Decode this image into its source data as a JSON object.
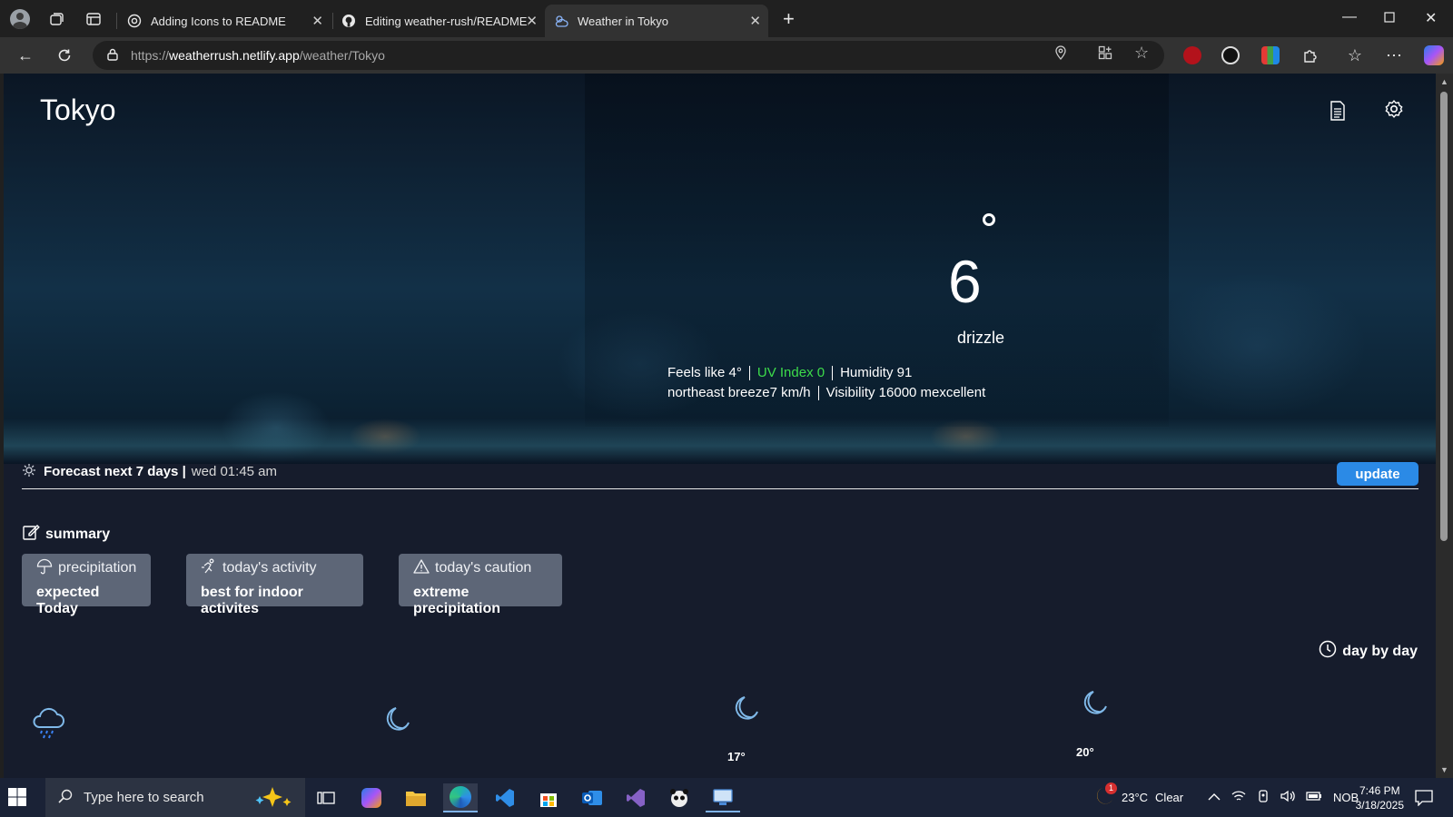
{
  "browser": {
    "tabs": [
      {
        "title": "Adding Icons to README",
        "active": false
      },
      {
        "title": "Editing weather-rush/README.md",
        "active": false
      },
      {
        "title": "Weather in Tokyo",
        "active": true
      }
    ],
    "url_prefix": "https://",
    "url_host": "weatherrush.netlify.app",
    "url_path": "/weather/Tokyo"
  },
  "weather": {
    "city": "Tokyo",
    "temperature": "6",
    "condition": "drizzle",
    "feels_like": "Feels like 4°",
    "uv_index": "UV Index 0",
    "humidity": "Humidity 91",
    "wind": "northeast breeze7 km/h",
    "visibility": "Visibility 16000 mexcellent",
    "colors": {
      "uv": "#3ddc4a",
      "accent": "#2b8ae6"
    }
  },
  "forecast": {
    "title": "Forecast next 7 days |",
    "time": "wed 01:45 am",
    "update_label": "update",
    "summary_label": "summary",
    "cards": [
      {
        "heading": "precipitation",
        "value": "expected Today",
        "icon": "umbrella-icon"
      },
      {
        "heading": "today's activity",
        "value": "best for indoor activites",
        "icon": "running-icon"
      },
      {
        "heading": "today's caution",
        "value": "extreme precipitation",
        "icon": "warning-icon"
      }
    ],
    "day_by_day_label": "day by day",
    "days": [
      {
        "icon": "rain-cloud-icon",
        "temp": ""
      },
      {
        "icon": "moon-icon",
        "temp": ""
      },
      {
        "icon": "moon-icon",
        "temp": "17°"
      },
      {
        "icon": "moon-icon",
        "temp": "20°"
      }
    ]
  },
  "taskbar": {
    "search_placeholder": "Type here to search",
    "weather_temp": "23°C",
    "weather_text": "Clear",
    "weather_badge": "1",
    "language": "NOB",
    "time": "7:46 PM",
    "date": "3/18/2025"
  }
}
